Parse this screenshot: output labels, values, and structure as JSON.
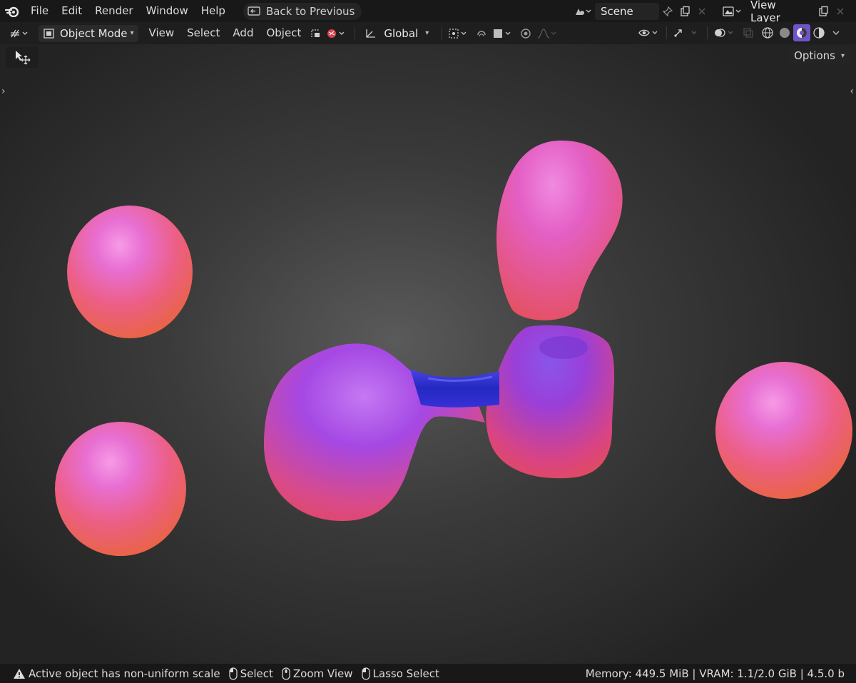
{
  "topbar": {
    "menus": [
      "File",
      "Edit",
      "Render",
      "Window",
      "Help"
    ],
    "back_label": "Back to Previous",
    "scene_label": "Scene",
    "view_layer_label": "View Layer"
  },
  "header": {
    "mode_label": "Object Mode",
    "menus": [
      "View",
      "Select",
      "Add",
      "Object"
    ],
    "orientation_label": "Global"
  },
  "viewport": {
    "options_label": "Options"
  },
  "statusbar": {
    "warning_text": "Active object has non-uniform scale",
    "hint_select": "Select",
    "hint_zoom": "Zoom View",
    "hint_lasso": "Lasso Select",
    "stats": "Memory: 449.5 MiB | VRAM: 1.1/2.0 GiB | 4.5.0 b"
  },
  "colors": {
    "accent": "#6f54c9",
    "blob_pink": "#e66bd2",
    "blob_orange": "#e8633f",
    "blob_violet": "#8a3fe0",
    "bridge_blue": "#2a2fc8"
  }
}
